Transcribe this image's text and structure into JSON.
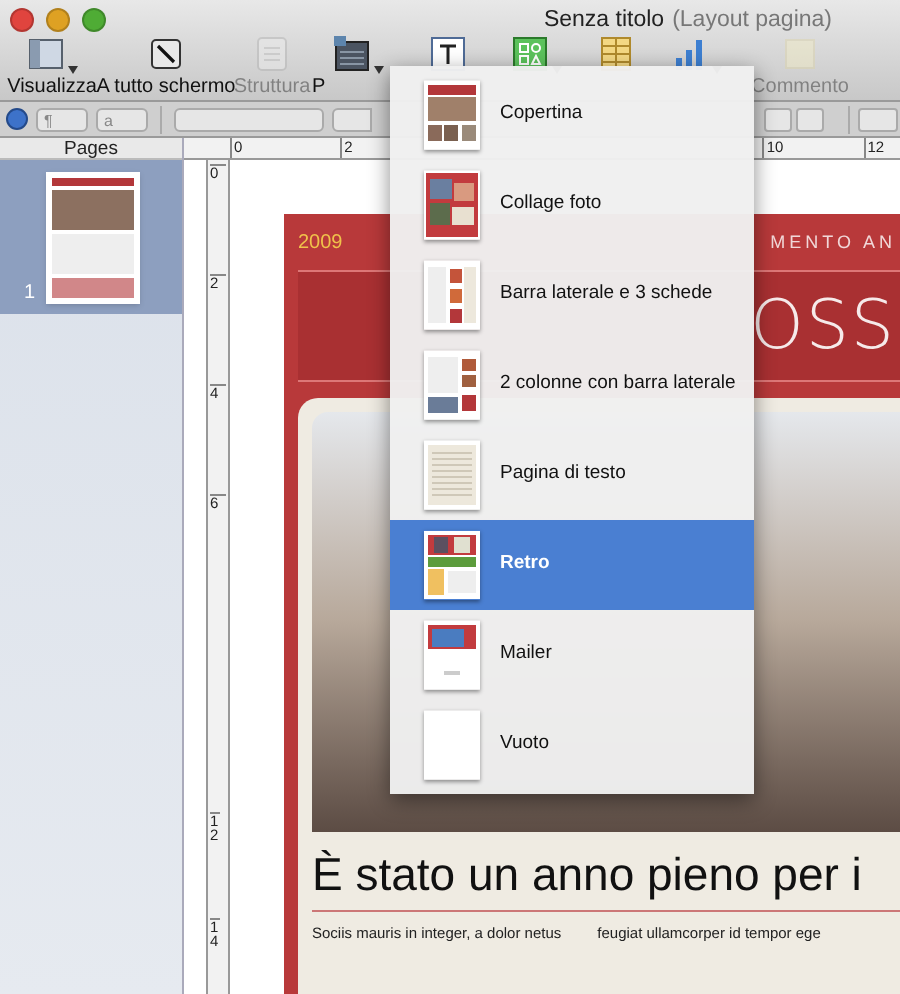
{
  "window": {
    "title": "Senza titolo",
    "subtitle": "(Layout pagina)"
  },
  "toolbar": [
    {
      "label": "Visualizza",
      "disabled": false,
      "dropdown": true
    },
    {
      "label": "A tutto schermo",
      "disabled": false,
      "dropdown": false
    },
    {
      "label": "Struttura",
      "disabled": true,
      "dropdown": false
    },
    {
      "label": "P",
      "disabled": false,
      "dropdown": true
    },
    {
      "disabled": false,
      "dropdown": false
    },
    {
      "disabled": false,
      "dropdown": true
    },
    {
      "disabled": false,
      "dropdown": false
    },
    {
      "disabled": false,
      "dropdown": true
    },
    {
      "label": "Commento",
      "disabled": true,
      "dropdown": false
    }
  ],
  "format_bar": {
    "popups": [
      "¶",
      "a"
    ]
  },
  "sidebar": {
    "title": "Pages",
    "pages": [
      {
        "number": "1",
        "selected": true
      }
    ]
  },
  "rulers": {
    "horizontal": [
      "0",
      "2",
      "10",
      "12"
    ],
    "vertical": [
      "0",
      "2",
      "4",
      "6",
      "12",
      "14"
    ]
  },
  "document": {
    "year": "2009",
    "banner": "MENTO AN",
    "title": "OSS",
    "heading": "È stato un anno pieno per i",
    "columns": [
      "Sociis mauris in integer, a dolor netus",
      "feugiat ullamcorper id tempor ege"
    ]
  },
  "menu": {
    "items": [
      {
        "label": "Copertina",
        "kind": "cover",
        "selected": false
      },
      {
        "label": "Collage foto",
        "kind": "collage",
        "selected": false
      },
      {
        "label": "Barra laterale e 3 schede",
        "kind": "sidebar",
        "selected": false
      },
      {
        "label": "2 colonne con barra laterale",
        "kind": "columns",
        "selected": false
      },
      {
        "label": "Pagina di testo",
        "kind": "text",
        "selected": false
      },
      {
        "label": "Retro",
        "kind": "retro",
        "selected": true
      },
      {
        "label": "Mailer",
        "kind": "mailer",
        "selected": false
      },
      {
        "label": "Vuoto",
        "kind": "blank",
        "selected": false
      }
    ]
  }
}
